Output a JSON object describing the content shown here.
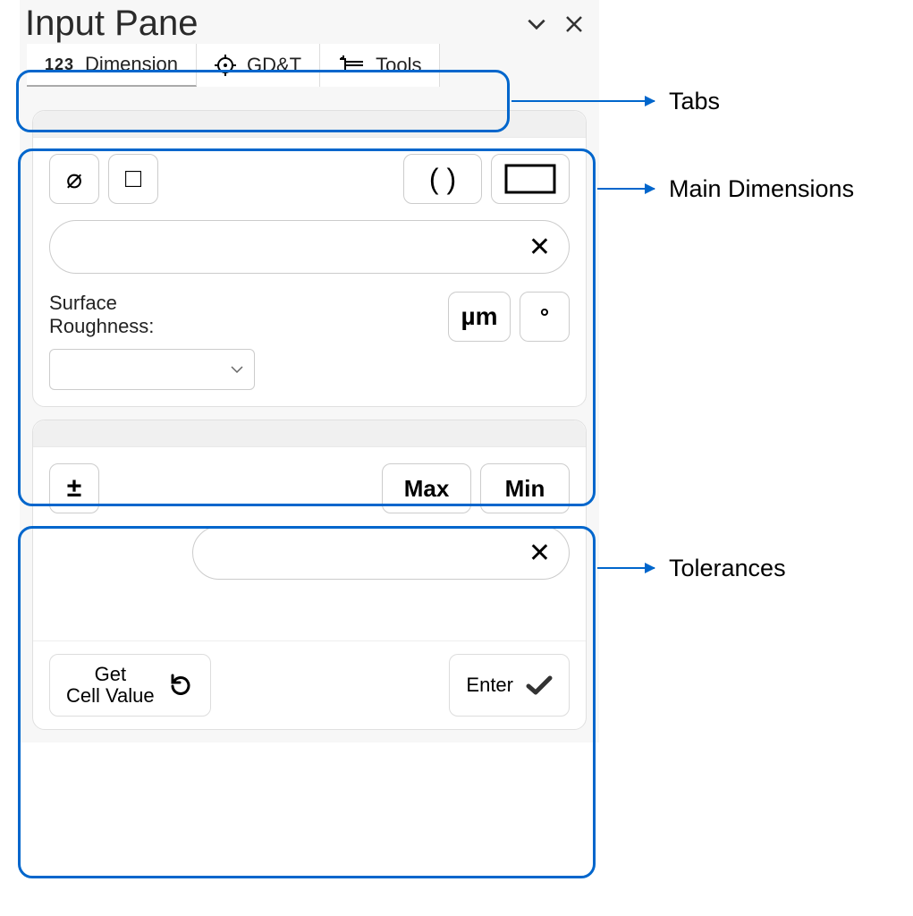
{
  "header": {
    "title": "Input Pane"
  },
  "tabs": [
    {
      "label": "Dimension",
      "icon": "123"
    },
    {
      "label": "GD&T",
      "icon": "target"
    },
    {
      "label": "Tools",
      "icon": "caliper"
    }
  ],
  "mainDimensions": {
    "symbolButtons": {
      "diameter": "⌀",
      "square": "□",
      "parens": "( )",
      "frame": "▭"
    },
    "inputValue": "",
    "clearIcon": "✕",
    "surfaceRoughnessLabel1": "Surface",
    "surfaceRoughnessLabel2": "Roughness:",
    "unitMicron": "µm",
    "unitDegree": "°",
    "roughnessSelected": ""
  },
  "tolerances": {
    "plusMinus": "±",
    "maxLabel": "Max",
    "minLabel": "Min",
    "inputValue": "",
    "clearIcon": "✕",
    "getCellLine1": "Get",
    "getCellLine2": "Cell Value",
    "enterLabel": "Enter"
  },
  "annotations": {
    "tabs": "Tabs",
    "main": "Main Dimensions",
    "tol": "Tolerances"
  }
}
